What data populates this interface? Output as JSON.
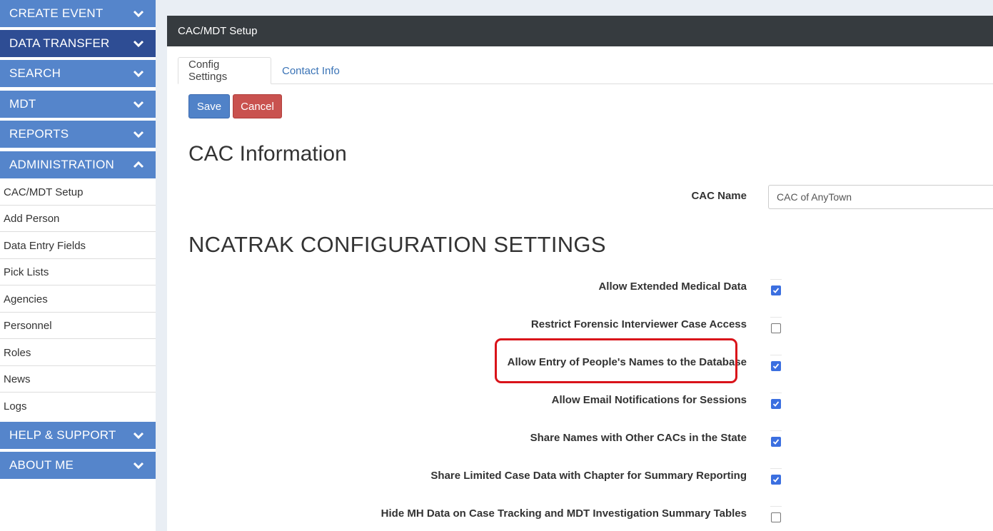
{
  "sidebar": {
    "top_sections": [
      {
        "label": "CREATE EVENT",
        "chevron": "chevron-down-icon"
      },
      {
        "label": "DATA TRANSFER",
        "chevron": "chevron-down-icon"
      },
      {
        "label": "SEARCH",
        "chevron": "chevron-down-icon"
      },
      {
        "label": "MDT",
        "chevron": "chevron-down-icon"
      },
      {
        "label": "REPORTS",
        "chevron": "chevron-down-icon"
      },
      {
        "label": "ADMINISTRATION",
        "chevron": "chevron-up-icon"
      }
    ],
    "admin_items": [
      "CAC/MDT Setup",
      "Add Person",
      "Data Entry Fields",
      "Pick Lists",
      "Agencies",
      "Personnel",
      "Roles",
      "News",
      "Logs"
    ],
    "bottom_sections": [
      {
        "label": "HELP & SUPPORT",
        "chevron": "chevron-down-icon"
      },
      {
        "label": "ABOUT ME",
        "chevron": "chevron-down-icon"
      }
    ]
  },
  "panel": {
    "title": "CAC/MDT Setup",
    "tabs": [
      {
        "label": "Config Settings",
        "active": true
      },
      {
        "label": "Contact Info",
        "active": false
      }
    ],
    "save_label": "Save",
    "cancel_label": "Cancel"
  },
  "cac_info": {
    "heading": "CAC Information",
    "name_label": "CAC Name",
    "name_value": "CAC of AnyTown"
  },
  "config": {
    "heading": "NCATRAK CONFIGURATION SETTINGS",
    "settings": [
      {
        "label": "Allow Extended Medical Data",
        "checked": true
      },
      {
        "label": "Restrict Forensic Interviewer Case Access",
        "checked": false
      },
      {
        "label": "Allow Entry of People's Names to the Database",
        "checked": true,
        "highlighted": true
      },
      {
        "label": "Allow Email Notifications for Sessions",
        "checked": true
      },
      {
        "label": "Share Names with Other CACs in the State",
        "checked": true
      },
      {
        "label": "Share Limited Case Data with Chapter for Summary Reporting",
        "checked": true
      },
      {
        "label": "Hide MH Data on Case Tracking and MDT Investigation Summary Tables",
        "checked": false
      }
    ]
  },
  "colors": {
    "nav_blue": "#5585cb",
    "nav_active": "#2e4d94",
    "header_dark": "#363b3f",
    "save_blue": "#5082c8",
    "cancel_red": "#c9524f",
    "highlight_red": "#d9131a",
    "checkbox_blue": "#3b6fe0"
  }
}
